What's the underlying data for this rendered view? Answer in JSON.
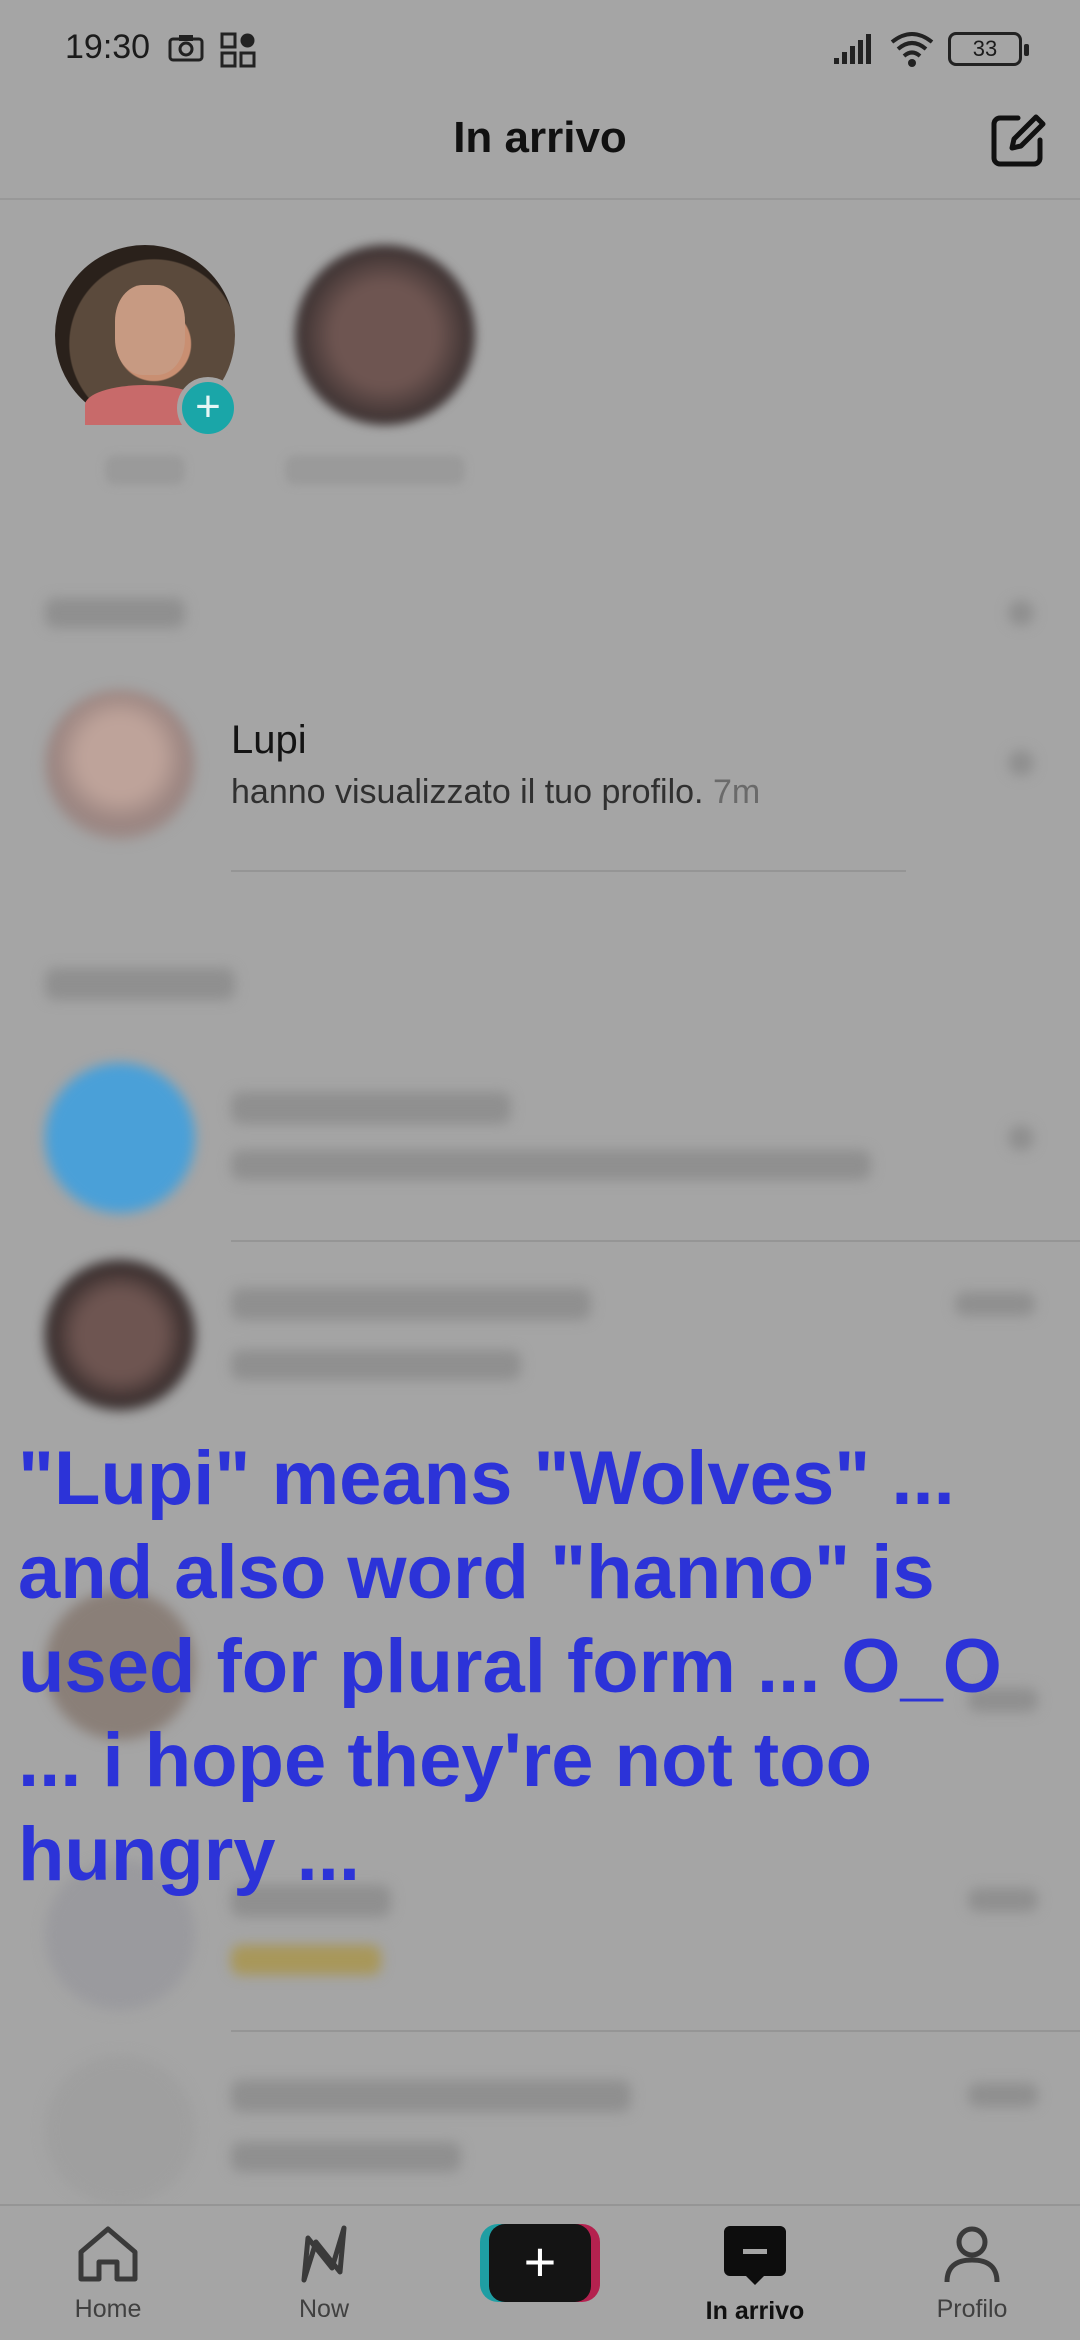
{
  "status_bar": {
    "time": "19:30",
    "battery": "33"
  },
  "header": {
    "title": "In arrivo"
  },
  "activity": {
    "name": "Lupi",
    "text": "hanno visualizzato il tuo profilo.",
    "time": "7m"
  },
  "caption": "\"Lupi\" means \"Wolves\" ... and also word \"hanno\" is used for plural form ... O_O ... i hope they're not too hungry ...",
  "bottom_nav": {
    "home": "Home",
    "now": "Now",
    "inbox": "In arrivo",
    "profile": "Profilo"
  },
  "colors": {
    "caption": "#2c33d8",
    "story_plus": "#1aa6a8"
  }
}
